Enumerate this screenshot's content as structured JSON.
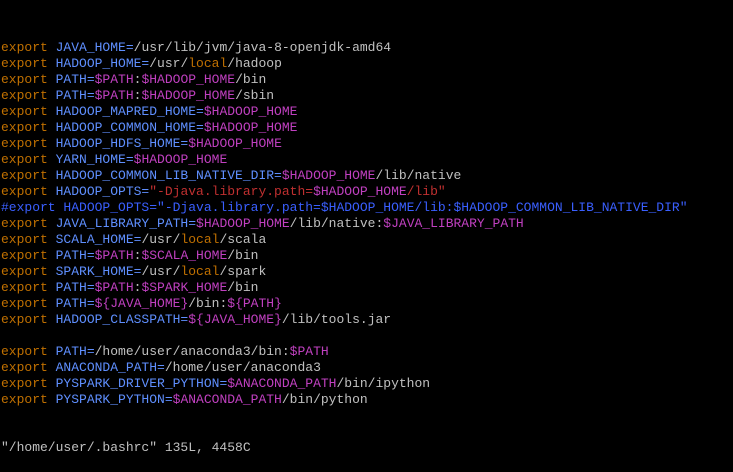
{
  "colors": {
    "background": "#000000",
    "keyword": "#c07000",
    "variable": "#5f8fff",
    "text": "#c0c0c0",
    "reference": "#c040c0",
    "string": "#c03030",
    "comment": "#3a5fff"
  },
  "lines": [
    {
      "segs": [
        {
          "t": "export",
          "c": "kw"
        },
        {
          "t": " JAVA_HOME=",
          "c": "var"
        },
        {
          "t": "/usr/lib/jvm/java-8-openjdk-amd64",
          "c": "txt"
        }
      ]
    },
    {
      "segs": [
        {
          "t": "export",
          "c": "kw"
        },
        {
          "t": " HADOOP_HOME=",
          "c": "var"
        },
        {
          "t": "/usr/",
          "c": "txt"
        },
        {
          "t": "local",
          "c": "kw"
        },
        {
          "t": "/hadoop",
          "c": "txt"
        }
      ]
    },
    {
      "segs": [
        {
          "t": "export",
          "c": "kw"
        },
        {
          "t": " PATH=",
          "c": "var"
        },
        {
          "t": "$PATH",
          "c": "ref"
        },
        {
          "t": ":",
          "c": "txt"
        },
        {
          "t": "$HADOOP_HOME",
          "c": "ref"
        },
        {
          "t": "/bin",
          "c": "txt"
        }
      ]
    },
    {
      "segs": [
        {
          "t": "export",
          "c": "kw"
        },
        {
          "t": " PATH=",
          "c": "var"
        },
        {
          "t": "$PATH",
          "c": "ref"
        },
        {
          "t": ":",
          "c": "txt"
        },
        {
          "t": "$HADOOP_HOME",
          "c": "ref"
        },
        {
          "t": "/sbin",
          "c": "txt"
        }
      ]
    },
    {
      "segs": [
        {
          "t": "export",
          "c": "kw"
        },
        {
          "t": " HADOOP_MAPRED_HOME=",
          "c": "var"
        },
        {
          "t": "$HADOOP_HOME",
          "c": "ref"
        }
      ]
    },
    {
      "segs": [
        {
          "t": "export",
          "c": "kw"
        },
        {
          "t": " HADOOP_COMMON_HOME=",
          "c": "var"
        },
        {
          "t": "$HADOOP_HOME",
          "c": "ref"
        }
      ]
    },
    {
      "segs": [
        {
          "t": "export",
          "c": "kw"
        },
        {
          "t": " HADOOP_HDFS_HOME=",
          "c": "var"
        },
        {
          "t": "$HADOOP_HOME",
          "c": "ref"
        }
      ]
    },
    {
      "segs": [
        {
          "t": "export",
          "c": "kw"
        },
        {
          "t": " YARN_HOME=",
          "c": "var"
        },
        {
          "t": "$HADOOP_HOME",
          "c": "ref"
        }
      ]
    },
    {
      "segs": [
        {
          "t": "export",
          "c": "kw"
        },
        {
          "t": " HADOOP_COMMON_LIB_NATIVE_DIR=",
          "c": "var"
        },
        {
          "t": "$HADOOP_HOME",
          "c": "ref"
        },
        {
          "t": "/lib/native",
          "c": "txt"
        }
      ]
    },
    {
      "segs": [
        {
          "t": "export",
          "c": "kw"
        },
        {
          "t": " HADOOP_OPTS=",
          "c": "var"
        },
        {
          "t": "\"-Djava.library.path=",
          "c": "str"
        },
        {
          "t": "$HADOOP_HOME",
          "c": "ref"
        },
        {
          "t": "/lib\"",
          "c": "str"
        }
      ]
    },
    {
      "segs": [
        {
          "t": "#export HADOOP_OPTS=\"-Djava.library.path=$HADOOP_HOME/lib:$HADOOP_COMMON_LIB_NATIVE_DIR\"",
          "c": "cmt"
        }
      ]
    },
    {
      "segs": [
        {
          "t": "export",
          "c": "kw"
        },
        {
          "t": " JAVA_LIBRARY_PATH=",
          "c": "var"
        },
        {
          "t": "$HADOOP_HOME",
          "c": "ref"
        },
        {
          "t": "/lib/native:",
          "c": "txt"
        },
        {
          "t": "$JAVA_LIBRARY_PATH",
          "c": "ref"
        }
      ]
    },
    {
      "segs": [
        {
          "t": "export",
          "c": "kw"
        },
        {
          "t": " SCALA_HOME=",
          "c": "var"
        },
        {
          "t": "/usr/",
          "c": "txt"
        },
        {
          "t": "local",
          "c": "kw"
        },
        {
          "t": "/scala",
          "c": "txt"
        }
      ]
    },
    {
      "segs": [
        {
          "t": "export",
          "c": "kw"
        },
        {
          "t": " PATH=",
          "c": "var"
        },
        {
          "t": "$PATH",
          "c": "ref"
        },
        {
          "t": ":",
          "c": "txt"
        },
        {
          "t": "$SCALA_HOME",
          "c": "ref"
        },
        {
          "t": "/bin",
          "c": "txt"
        }
      ]
    },
    {
      "segs": [
        {
          "t": "export",
          "c": "kw"
        },
        {
          "t": " SPARK_HOME=",
          "c": "var"
        },
        {
          "t": "/usr/",
          "c": "txt"
        },
        {
          "t": "local",
          "c": "kw"
        },
        {
          "t": "/spark",
          "c": "txt"
        }
      ]
    },
    {
      "segs": [
        {
          "t": "export",
          "c": "kw"
        },
        {
          "t": " PATH=",
          "c": "var"
        },
        {
          "t": "$PATH",
          "c": "ref"
        },
        {
          "t": ":",
          "c": "txt"
        },
        {
          "t": "$SPARK_HOME",
          "c": "ref"
        },
        {
          "t": "/bin",
          "c": "txt"
        }
      ]
    },
    {
      "segs": [
        {
          "t": "export",
          "c": "kw"
        },
        {
          "t": " PATH=",
          "c": "var"
        },
        {
          "t": "${JAVA_HOME}",
          "c": "ref"
        },
        {
          "t": "/bin:",
          "c": "txt"
        },
        {
          "t": "${PATH}",
          "c": "ref"
        }
      ]
    },
    {
      "segs": [
        {
          "t": "export",
          "c": "kw"
        },
        {
          "t": " HADOOP_CLASSPATH=",
          "c": "var"
        },
        {
          "t": "${JAVA_HOME}",
          "c": "ref"
        },
        {
          "t": "/lib/tools.jar",
          "c": "txt"
        }
      ]
    },
    {
      "segs": []
    },
    {
      "segs": [
        {
          "t": "export",
          "c": "kw"
        },
        {
          "t": " PATH=",
          "c": "var"
        },
        {
          "t": "/home/user/anaconda3/bin:",
          "c": "txt"
        },
        {
          "t": "$PATH",
          "c": "ref"
        }
      ]
    },
    {
      "segs": [
        {
          "t": "export",
          "c": "kw"
        },
        {
          "t": " ANACONDA_PATH=",
          "c": "var"
        },
        {
          "t": "/home/user/anaconda3",
          "c": "txt"
        }
      ]
    },
    {
      "segs": [
        {
          "t": "export",
          "c": "kw"
        },
        {
          "t": " PYSPARK_DRIVER_PYTHON=",
          "c": "var"
        },
        {
          "t": "$ANACONDA_PATH",
          "c": "ref"
        },
        {
          "t": "/bin/ipython",
          "c": "txt"
        }
      ]
    },
    {
      "segs": [
        {
          "t": "export",
          "c": "kw"
        },
        {
          "t": " PYSPARK_PYTHON=",
          "c": "var"
        },
        {
          "t": "$ANACONDA_PATH",
          "c": "ref"
        },
        {
          "t": "/bin/python",
          "c": "txt"
        }
      ]
    }
  ],
  "status_line": "\"/home/user/.bashrc\" 135L, 4458C"
}
